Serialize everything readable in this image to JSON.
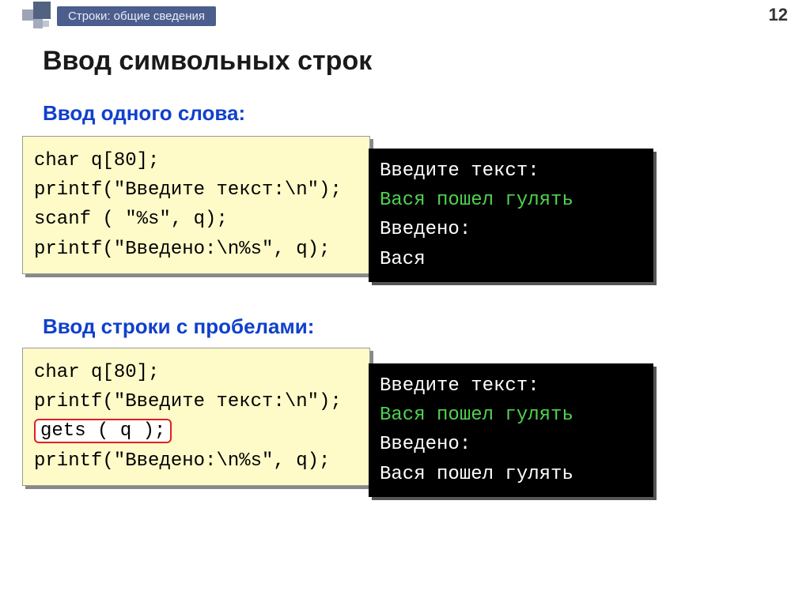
{
  "page_number": "12",
  "breadcrumb": "Строки: общие сведения",
  "title": "Ввод символьных строк",
  "section1": {
    "heading": "Ввод одного слова:",
    "code": {
      "l1": "char q[80];",
      "l2": "printf(\"Введите текст:\\n\");",
      "l3": "scanf ( \"%s\", q);",
      "l4": "printf(\"Введено:\\n%s\", q);"
    },
    "term": {
      "l1": "Введите текст:",
      "l2": "Вася пошел гулять",
      "l3": "Введено:",
      "l4": "Вася"
    }
  },
  "section2": {
    "heading": "Ввод строки с пробелами:",
    "code": {
      "l1": "char q[80];",
      "l2": "printf(\"Введите текст:\\n\");",
      "l3": "gets ( q );",
      "l4": "printf(\"Введено:\\n%s\", q);"
    },
    "term": {
      "l1": "Введите текст:",
      "l2": "Вася пошел гулять",
      "l3": "Введено:",
      "l4": "Вася пошел гулять"
    }
  }
}
